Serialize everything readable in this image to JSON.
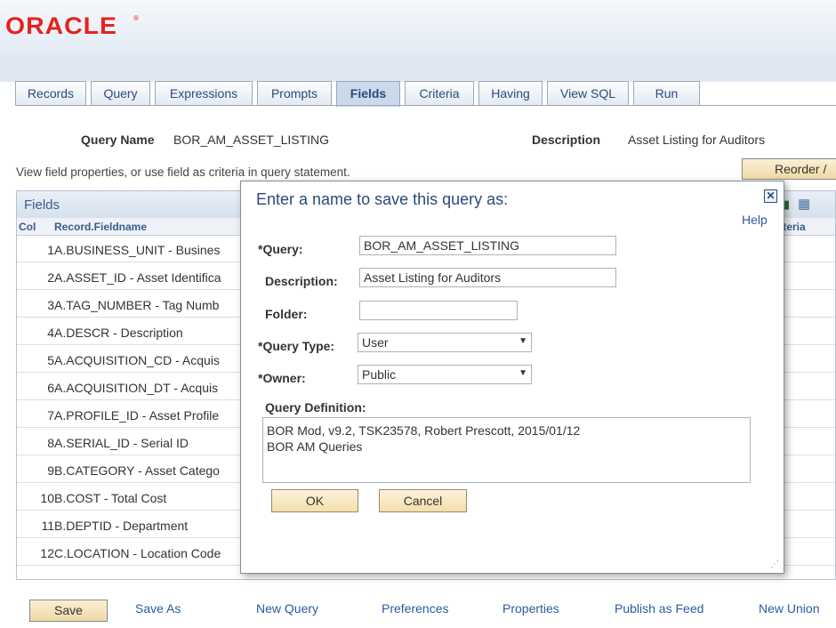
{
  "brand": {
    "logo": "ORACLE",
    "tm": "®"
  },
  "tabs": [
    {
      "label": "Records"
    },
    {
      "label": "Query"
    },
    {
      "label": "Expressions"
    },
    {
      "label": "Prompts"
    },
    {
      "label": "Fields"
    },
    {
      "label": "Criteria"
    },
    {
      "label": "Having"
    },
    {
      "label": "View SQL"
    },
    {
      "label": "Run"
    }
  ],
  "active_tab": "Fields",
  "header": {
    "query_name_label": "Query Name",
    "query_name": "BOR_AM_ASSET_LISTING",
    "description_label": "Description",
    "description": "Asset Listing for Auditors",
    "help_text": "View field properties, or use field as criteria in query statement.",
    "reorder_label": "Reorder /"
  },
  "grid": {
    "title": "Fields",
    "columns": [
      "Col",
      "Record.Fieldname",
      "iteria"
    ],
    "rows": [
      {
        "col": "1",
        "field": "A.BUSINESS_UNIT - Busines"
      },
      {
        "col": "2",
        "field": "A.ASSET_ID - Asset Identifica"
      },
      {
        "col": "3",
        "field": "A.TAG_NUMBER - Tag Numb"
      },
      {
        "col": "4",
        "field": "A.DESCR - Description"
      },
      {
        "col": "5",
        "field": "A.ACQUISITION_CD - Acquis"
      },
      {
        "col": "6",
        "field": "A.ACQUISITION_DT - Acquis"
      },
      {
        "col": "7",
        "field": "A.PROFILE_ID - Asset Profile"
      },
      {
        "col": "8",
        "field": "A.SERIAL_ID - Serial ID"
      },
      {
        "col": "9",
        "field": "B.CATEGORY - Asset Catego"
      },
      {
        "col": "10",
        "field": "B.COST - Total Cost"
      },
      {
        "col": "11",
        "field": "B.DEPTID - Department"
      },
      {
        "col": "12",
        "field": "C.LOCATION - Location Code"
      }
    ]
  },
  "footer": {
    "save": "Save",
    "links": [
      "Save As",
      "New Query",
      "Preferences",
      "Properties",
      "Publish as Feed",
      "New Union"
    ]
  },
  "modal": {
    "title": "Enter a name to save this query as:",
    "help": "Help",
    "query_label": "*Query:",
    "query_value": "BOR_AM_ASSET_LISTING",
    "description_label": "Description:",
    "description_value": "Asset Listing for Auditors",
    "folder_label": "Folder:",
    "folder_value": "",
    "query_type_label": "*Query Type:",
    "query_type_value": "User",
    "owner_label": "*Owner:",
    "owner_value": "Public",
    "definition_label": "Query Definition:",
    "definition_value": "BOR Mod, v9.2, TSK23578, Robert Prescott, 2015/01/12\nBOR AM Queries",
    "ok": "OK",
    "cancel": "Cancel"
  },
  "colors": {
    "accent": "#2b4a7a",
    "brand": "#e5221f",
    "button": "#eed9a4"
  }
}
